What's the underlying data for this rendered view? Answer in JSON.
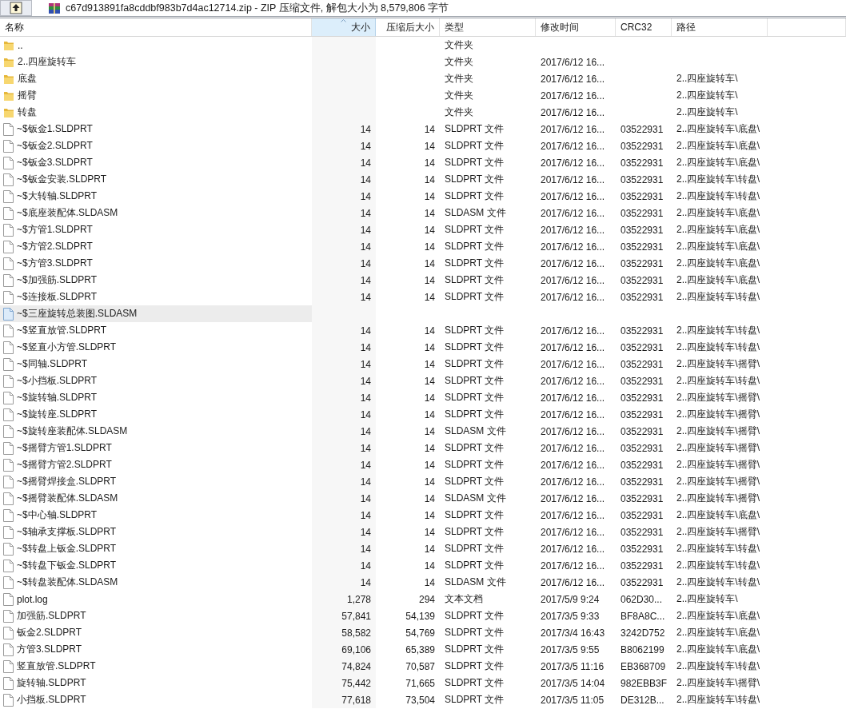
{
  "toolbar": {
    "title": "c67d913891fa8cddbf983b7d4ac12714.zip - ZIP 压缩文件, 解包大小为 8,579,806 字节"
  },
  "columns": [
    {
      "label": "名称",
      "sorted": false
    },
    {
      "label": "大小",
      "sorted": true
    },
    {
      "label": "压缩后大小",
      "sorted": false
    },
    {
      "label": "类型",
      "sorted": false
    },
    {
      "label": "修改时间",
      "sorted": false
    },
    {
      "label": "CRC32",
      "sorted": false
    },
    {
      "label": "路径",
      "sorted": false
    }
  ],
  "rows": [
    {
      "kind": "folder",
      "name": "..",
      "size": "",
      "packed": "",
      "type": "文件夹",
      "modified": "",
      "crc": "",
      "path": "",
      "selected": false
    },
    {
      "kind": "folder",
      "name": "2..四座旋转车",
      "size": "",
      "packed": "",
      "type": "文件夹",
      "modified": "2017/6/12 16...",
      "crc": "",
      "path": "",
      "selected": false
    },
    {
      "kind": "folder",
      "name": "底盘",
      "size": "",
      "packed": "",
      "type": "文件夹",
      "modified": "2017/6/12 16...",
      "crc": "",
      "path": "2..四座旋转车\\",
      "selected": false
    },
    {
      "kind": "folder",
      "name": "摇臂",
      "size": "",
      "packed": "",
      "type": "文件夹",
      "modified": "2017/6/12 16...",
      "crc": "",
      "path": "2..四座旋转车\\",
      "selected": false
    },
    {
      "kind": "folder",
      "name": "转盘",
      "size": "",
      "packed": "",
      "type": "文件夹",
      "modified": "2017/6/12 16...",
      "crc": "",
      "path": "2..四座旋转车\\",
      "selected": false
    },
    {
      "kind": "file",
      "name": "~$钣金1.SLDPRT",
      "size": "14",
      "packed": "14",
      "type": "SLDPRT 文件",
      "modified": "2017/6/12 16...",
      "crc": "03522931",
      "path": "2..四座旋转车\\底盘\\",
      "selected": false
    },
    {
      "kind": "file",
      "name": "~$钣金2.SLDPRT",
      "size": "14",
      "packed": "14",
      "type": "SLDPRT 文件",
      "modified": "2017/6/12 16...",
      "crc": "03522931",
      "path": "2..四座旋转车\\底盘\\",
      "selected": false
    },
    {
      "kind": "file",
      "name": "~$钣金3.SLDPRT",
      "size": "14",
      "packed": "14",
      "type": "SLDPRT 文件",
      "modified": "2017/6/12 16...",
      "crc": "03522931",
      "path": "2..四座旋转车\\底盘\\",
      "selected": false
    },
    {
      "kind": "file",
      "name": "~$钣金安装.SLDPRT",
      "size": "14",
      "packed": "14",
      "type": "SLDPRT 文件",
      "modified": "2017/6/12 16...",
      "crc": "03522931",
      "path": "2..四座旋转车\\转盘\\",
      "selected": false
    },
    {
      "kind": "file",
      "name": "~$大转轴.SLDPRT",
      "size": "14",
      "packed": "14",
      "type": "SLDPRT 文件",
      "modified": "2017/6/12 16...",
      "crc": "03522931",
      "path": "2..四座旋转车\\转盘\\",
      "selected": false
    },
    {
      "kind": "file",
      "name": "~$底座装配体.SLDASM",
      "size": "14",
      "packed": "14",
      "type": "SLDASM 文件",
      "modified": "2017/6/12 16...",
      "crc": "03522931",
      "path": "2..四座旋转车\\底盘\\",
      "selected": false
    },
    {
      "kind": "file",
      "name": "~$方管1.SLDPRT",
      "size": "14",
      "packed": "14",
      "type": "SLDPRT 文件",
      "modified": "2017/6/12 16...",
      "crc": "03522931",
      "path": "2..四座旋转车\\底盘\\",
      "selected": false
    },
    {
      "kind": "file",
      "name": "~$方管2.SLDPRT",
      "size": "14",
      "packed": "14",
      "type": "SLDPRT 文件",
      "modified": "2017/6/12 16...",
      "crc": "03522931",
      "path": "2..四座旋转车\\底盘\\",
      "selected": false
    },
    {
      "kind": "file",
      "name": "~$方管3.SLDPRT",
      "size": "14",
      "packed": "14",
      "type": "SLDPRT 文件",
      "modified": "2017/6/12 16...",
      "crc": "03522931",
      "path": "2..四座旋转车\\底盘\\",
      "selected": false
    },
    {
      "kind": "file",
      "name": "~$加强筋.SLDPRT",
      "size": "14",
      "packed": "14",
      "type": "SLDPRT 文件",
      "modified": "2017/6/12 16...",
      "crc": "03522931",
      "path": "2..四座旋转车\\底盘\\",
      "selected": false
    },
    {
      "kind": "file",
      "name": "~$连接板.SLDPRT",
      "size": "14",
      "packed": "14",
      "type": "SLDPRT 文件",
      "modified": "2017/6/12 16...",
      "crc": "03522931",
      "path": "2..四座旋转车\\转盘\\",
      "selected": false
    },
    {
      "kind": "file",
      "name": "~$三座旋转总装图.SLDASM",
      "size": "",
      "packed": "",
      "type": "",
      "modified": "",
      "crc": "",
      "path": "",
      "selected": true
    },
    {
      "kind": "file",
      "name": "~$竖直放管.SLDPRT",
      "size": "14",
      "packed": "14",
      "type": "SLDPRT 文件",
      "modified": "2017/6/12 16...",
      "crc": "03522931",
      "path": "2..四座旋转车\\转盘\\",
      "selected": false
    },
    {
      "kind": "file",
      "name": "~$竖直小方管.SLDPRT",
      "size": "14",
      "packed": "14",
      "type": "SLDPRT 文件",
      "modified": "2017/6/12 16...",
      "crc": "03522931",
      "path": "2..四座旋转车\\转盘\\",
      "selected": false
    },
    {
      "kind": "file",
      "name": "~$同轴.SLDPRT",
      "size": "14",
      "packed": "14",
      "type": "SLDPRT 文件",
      "modified": "2017/6/12 16...",
      "crc": "03522931",
      "path": "2..四座旋转车\\摇臂\\",
      "selected": false
    },
    {
      "kind": "file",
      "name": "~$小挡板.SLDPRT",
      "size": "14",
      "packed": "14",
      "type": "SLDPRT 文件",
      "modified": "2017/6/12 16...",
      "crc": "03522931",
      "path": "2..四座旋转车\\转盘\\",
      "selected": false
    },
    {
      "kind": "file",
      "name": "~$旋转轴.SLDPRT",
      "size": "14",
      "packed": "14",
      "type": "SLDPRT 文件",
      "modified": "2017/6/12 16...",
      "crc": "03522931",
      "path": "2..四座旋转车\\摇臂\\",
      "selected": false
    },
    {
      "kind": "file",
      "name": "~$旋转座.SLDPRT",
      "size": "14",
      "packed": "14",
      "type": "SLDPRT 文件",
      "modified": "2017/6/12 16...",
      "crc": "03522931",
      "path": "2..四座旋转车\\摇臂\\",
      "selected": false
    },
    {
      "kind": "file",
      "name": "~$旋转座装配体.SLDASM",
      "size": "14",
      "packed": "14",
      "type": "SLDASM 文件",
      "modified": "2017/6/12 16...",
      "crc": "03522931",
      "path": "2..四座旋转车\\摇臂\\",
      "selected": false
    },
    {
      "kind": "file",
      "name": "~$摇臂方管1.SLDPRT",
      "size": "14",
      "packed": "14",
      "type": "SLDPRT 文件",
      "modified": "2017/6/12 16...",
      "crc": "03522931",
      "path": "2..四座旋转车\\摇臂\\",
      "selected": false
    },
    {
      "kind": "file",
      "name": "~$摇臂方管2.SLDPRT",
      "size": "14",
      "packed": "14",
      "type": "SLDPRT 文件",
      "modified": "2017/6/12 16...",
      "crc": "03522931",
      "path": "2..四座旋转车\\摇臂\\",
      "selected": false
    },
    {
      "kind": "file",
      "name": "~$摇臂焊接盒.SLDPRT",
      "size": "14",
      "packed": "14",
      "type": "SLDPRT 文件",
      "modified": "2017/6/12 16...",
      "crc": "03522931",
      "path": "2..四座旋转车\\摇臂\\",
      "selected": false
    },
    {
      "kind": "file",
      "name": "~$摇臂装配体.SLDASM",
      "size": "14",
      "packed": "14",
      "type": "SLDASM 文件",
      "modified": "2017/6/12 16...",
      "crc": "03522931",
      "path": "2..四座旋转车\\摇臂\\",
      "selected": false
    },
    {
      "kind": "file",
      "name": "~$中心轴.SLDPRT",
      "size": "14",
      "packed": "14",
      "type": "SLDPRT 文件",
      "modified": "2017/6/12 16...",
      "crc": "03522931",
      "path": "2..四座旋转车\\底盘\\",
      "selected": false
    },
    {
      "kind": "file",
      "name": "~$轴承支撑板.SLDPRT",
      "size": "14",
      "packed": "14",
      "type": "SLDPRT 文件",
      "modified": "2017/6/12 16...",
      "crc": "03522931",
      "path": "2..四座旋转车\\摇臂\\",
      "selected": false
    },
    {
      "kind": "file",
      "name": "~$转盘上钣金.SLDPRT",
      "size": "14",
      "packed": "14",
      "type": "SLDPRT 文件",
      "modified": "2017/6/12 16...",
      "crc": "03522931",
      "path": "2..四座旋转车\\转盘\\",
      "selected": false
    },
    {
      "kind": "file",
      "name": "~$转盘下钣金.SLDPRT",
      "size": "14",
      "packed": "14",
      "type": "SLDPRT 文件",
      "modified": "2017/6/12 16...",
      "crc": "03522931",
      "path": "2..四座旋转车\\转盘\\",
      "selected": false
    },
    {
      "kind": "file",
      "name": "~$转盘装配体.SLDASM",
      "size": "14",
      "packed": "14",
      "type": "SLDASM 文件",
      "modified": "2017/6/12 16...",
      "crc": "03522931",
      "path": "2..四座旋转车\\转盘\\",
      "selected": false
    },
    {
      "kind": "file",
      "name": "plot.log",
      "size": "1,278",
      "packed": "294",
      "type": "文本文档",
      "modified": "2017/5/9 9:24",
      "crc": "062D30...",
      "path": "2..四座旋转车\\",
      "selected": false
    },
    {
      "kind": "file",
      "name": "加强筋.SLDPRT",
      "size": "57,841",
      "packed": "54,139",
      "type": "SLDPRT 文件",
      "modified": "2017/3/5 9:33",
      "crc": "BF8A8C...",
      "path": "2..四座旋转车\\底盘\\",
      "selected": false
    },
    {
      "kind": "file",
      "name": "钣金2.SLDPRT",
      "size": "58,582",
      "packed": "54,769",
      "type": "SLDPRT 文件",
      "modified": "2017/3/4 16:43",
      "crc": "3242D752",
      "path": "2..四座旋转车\\底盘\\",
      "selected": false
    },
    {
      "kind": "file",
      "name": "方管3.SLDPRT",
      "size": "69,106",
      "packed": "65,389",
      "type": "SLDPRT 文件",
      "modified": "2017/3/5 9:55",
      "crc": "B8062199",
      "path": "2..四座旋转车\\底盘\\",
      "selected": false
    },
    {
      "kind": "file",
      "name": "竖直放管.SLDPRT",
      "size": "74,824",
      "packed": "70,587",
      "type": "SLDPRT 文件",
      "modified": "2017/3/5 11:16",
      "crc": "EB368709",
      "path": "2..四座旋转车\\转盘\\",
      "selected": false
    },
    {
      "kind": "file",
      "name": "旋转轴.SLDPRT",
      "size": "75,442",
      "packed": "71,665",
      "type": "SLDPRT 文件",
      "modified": "2017/3/5 14:04",
      "crc": "982EBB3F",
      "path": "2..四座旋转车\\摇臂\\",
      "selected": false
    },
    {
      "kind": "file",
      "name": "小挡板.SLDPRT",
      "size": "77,618",
      "packed": "73,504",
      "type": "SLDPRT 文件",
      "modified": "2017/3/5 11:05",
      "crc": "DE312B...",
      "path": "2..四座旋转车\\转盘\\",
      "selected": false
    }
  ]
}
